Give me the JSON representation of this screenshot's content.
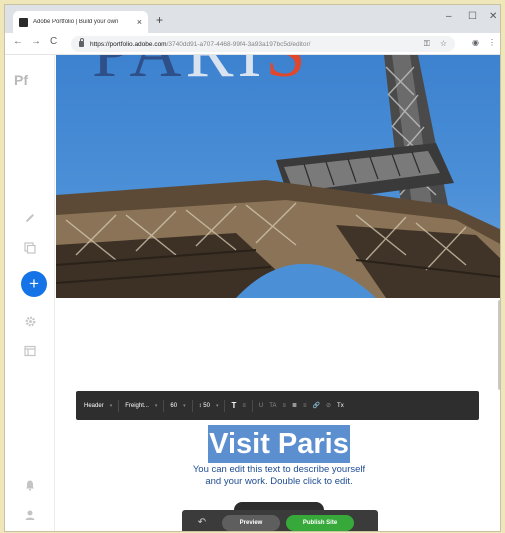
{
  "browser": {
    "tab_title": "Adobe Portfolio | Build your own",
    "new_tab": "+",
    "tab_close": "×",
    "window_minimize": "–",
    "window_maximize": "☐",
    "window_close": "✕",
    "nav_back": "←",
    "nav_forward": "→",
    "nav_reload": "C",
    "url_host": "https://portfolio.adobe.com",
    "url_path": "/3740dd91-a707-4468-99f4-3a93a197bc5d/editor/",
    "omnibox_icons": [
      "key-icon",
      "star-icon"
    ],
    "right_icons": [
      "profile-icon",
      "menu-icon"
    ]
  },
  "rail": {
    "logo": "Pf",
    "icons": [
      "pencil-icon",
      "pages-icon",
      "add-icon",
      "gear-icon",
      "layout-icon",
      "bell-icon",
      "user-icon"
    ],
    "add_label": "+"
  },
  "hero": {
    "title_part1": "PA",
    "title_part2": "RI",
    "title_part3": "S"
  },
  "format_toolbar": {
    "style": "Header",
    "font": "Freight...",
    "size": "60",
    "line_height_icon": "↕",
    "line_height": "50",
    "text_icon": "T",
    "tools": [
      "U",
      "TA",
      "≡",
      "≣",
      "≡",
      "🔗",
      "⊘",
      "Tx"
    ]
  },
  "content": {
    "heading": "Visit Paris",
    "body_line1": "You can edit this text to describe yourself",
    "body_line2": "and your work. Double click to edit."
  },
  "publish_bar": {
    "undo": "↶",
    "preview": "Preview",
    "publish": "Publish Site"
  },
  "colors": {
    "accent": "#1473e6",
    "publish": "#37a93a",
    "heading_bg": "#5b8fcf",
    "body_text": "#1e4c93"
  }
}
